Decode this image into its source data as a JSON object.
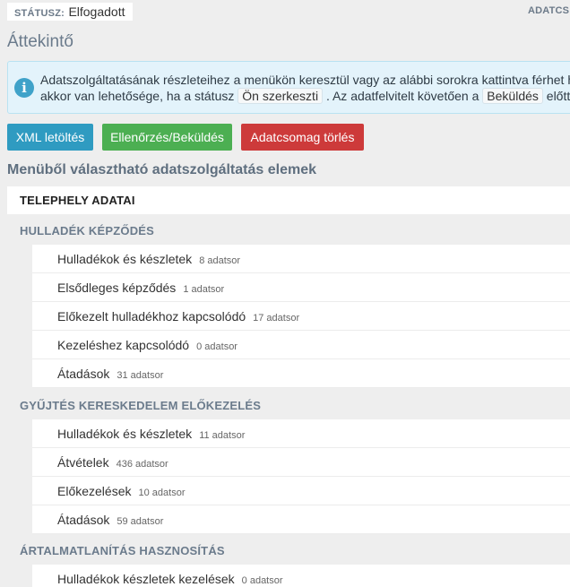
{
  "status": {
    "label": "STÁTUSZ:",
    "value": "Elfogadott"
  },
  "top_right": "ADATCS",
  "page_title": "Áttekintő",
  "info": {
    "icon": "info-icon",
    "line1": "Adatszolgáltatásának részleteihez a menükön keresztül vagy az alábbi sorokra kattintva férhet ho",
    "line2_pre": "akkor van lehetősége, ha a státusz",
    "line2_code1": "Ön szerkeszti",
    "line2_mid": ". Az adatfelvitelt követően a",
    "line2_code2": "Beküldés",
    "line2_post": "előtt ha"
  },
  "buttons": {
    "xml": "XML letöltés",
    "check": "Ellenőrzés/Beküldés",
    "delete": "Adatcsomag törlés"
  },
  "section_title": "Menüből választható adatszolgáltatás elemek",
  "site_label": "TELEPHELY ADATAI",
  "groups": [
    {
      "title": "HULLADÉK KÉPZŐDÉS",
      "items": [
        {
          "label": "Hulladékok és készletek",
          "count": "8 adatsor"
        },
        {
          "label": "Elsődleges képződés",
          "count": "1 adatsor"
        },
        {
          "label": "Előkezelt hulladékhoz kapcsolódó",
          "count": "17 adatsor"
        },
        {
          "label": "Kezeléshez kapcsolódó",
          "count": "0 adatsor"
        },
        {
          "label": "Átadások",
          "count": "31 adatsor"
        }
      ]
    },
    {
      "title": "GYŰJTÉS KERESKEDELEM ELŐKEZELÉS",
      "items": [
        {
          "label": "Hulladékok és készletek",
          "count": "11 adatsor"
        },
        {
          "label": "Átvételek",
          "count": "436 adatsor"
        },
        {
          "label": "Előkezelések",
          "count": "10 adatsor"
        },
        {
          "label": "Átadások",
          "count": "59 adatsor"
        }
      ]
    },
    {
      "title": "ÁRTALMATLANÍTÁS HASZNOSÍTÁS",
      "items": [
        {
          "label": "Hulladékok készletek kezelések",
          "count": "0 adatsor"
        }
      ]
    }
  ]
}
